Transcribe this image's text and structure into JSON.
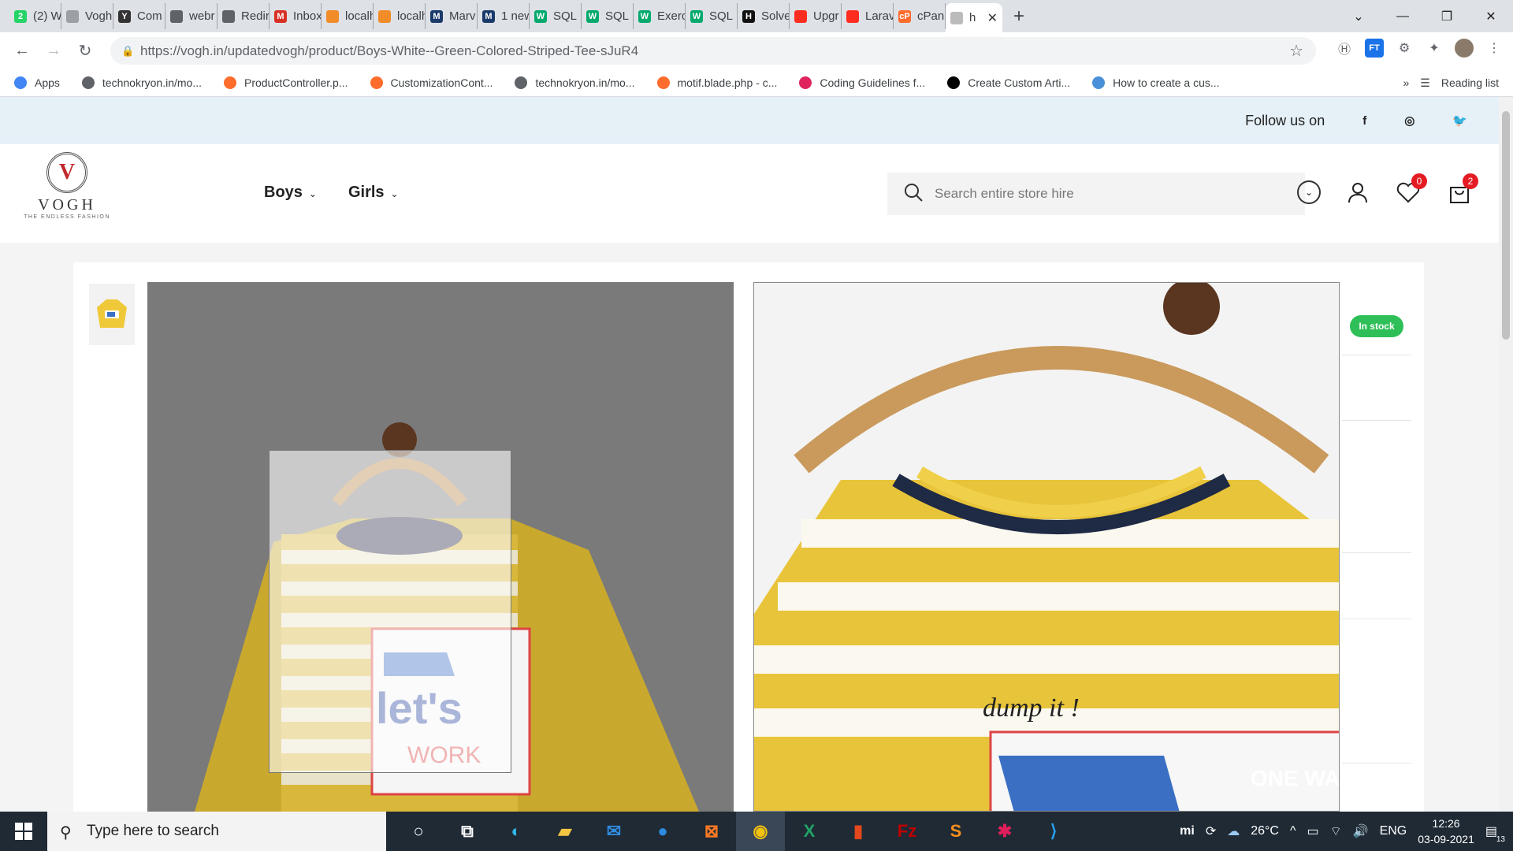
{
  "browser": {
    "tabs": [
      {
        "label": "(2) W",
        "icon": "whatsapp-icon",
        "color": "#25d366",
        "glyph": "2"
      },
      {
        "label": "Vogh",
        "icon": "page-icon",
        "color": "#9aa0a6",
        "glyph": ""
      },
      {
        "label": "Com",
        "icon": "yahoo-icon",
        "color": "#333333",
        "glyph": "Y"
      },
      {
        "label": "webr",
        "icon": "globe-icon",
        "color": "#5f6368",
        "glyph": ""
      },
      {
        "label": "Redir",
        "icon": "globe-icon",
        "color": "#5f6368",
        "glyph": ""
      },
      {
        "label": "Inbox",
        "icon": "gmail-icon",
        "color": "#d93025",
        "glyph": "M"
      },
      {
        "label": "localh",
        "icon": "phpmyadmin-icon",
        "color": "#f28c28",
        "glyph": ""
      },
      {
        "label": "localh",
        "icon": "phpmyadmin-icon",
        "color": "#f28c28",
        "glyph": ""
      },
      {
        "label": "Marv",
        "icon": "m-icon",
        "color": "#1a3a6b",
        "glyph": "M"
      },
      {
        "label": "1 new",
        "icon": "m-icon",
        "color": "#1a3a6b",
        "glyph": "M"
      },
      {
        "label": "SQL",
        "icon": "w3schools-icon",
        "color": "#04aa6d",
        "glyph": "W"
      },
      {
        "label": "SQL",
        "icon": "w3schools-icon",
        "color": "#04aa6d",
        "glyph": "W"
      },
      {
        "label": "Exerc",
        "icon": "w3schools-icon",
        "color": "#04aa6d",
        "glyph": "W"
      },
      {
        "label": "SQL",
        "icon": "w3schools-icon",
        "color": "#04aa6d",
        "glyph": "W"
      },
      {
        "label": "Solve",
        "icon": "hackerrank-icon",
        "color": "#111111",
        "glyph": "H"
      },
      {
        "label": "Upgr",
        "icon": "laravel-icon",
        "color": "#ff2d20",
        "glyph": ""
      },
      {
        "label": "Larav",
        "icon": "laravel-icon",
        "color": "#ff2d20",
        "glyph": ""
      },
      {
        "label": "cPan",
        "icon": "cpanel-icon",
        "color": "#ff6c2c",
        "glyph": "cP"
      }
    ],
    "active_tab": {
      "label": "h",
      "icon": "page-icon"
    },
    "url": "https://vogh.in/updatedvogh/product/Boys-White--Green-Colored-Striped-Tee-sJuR4",
    "bookmarks": [
      {
        "label": "Apps",
        "icon": "apps-grid-icon",
        "color": "#4285f4"
      },
      {
        "label": "technokryon.in/mo...",
        "icon": "globe-icon",
        "color": "#5f6368"
      },
      {
        "label": "ProductController.p...",
        "icon": "cpanel-icon",
        "color": "#ff6c2c"
      },
      {
        "label": "CustomizationCont...",
        "icon": "cpanel-icon",
        "color": "#ff6c2c"
      },
      {
        "label": "technokryon.in/mo...",
        "icon": "globe-icon",
        "color": "#5f6368"
      },
      {
        "label": "motif.blade.php - c...",
        "icon": "cpanel-icon",
        "color": "#ff6c2c"
      },
      {
        "label": "Coding Guidelines f...",
        "icon": "laravel-icon",
        "color": "#e0245e"
      },
      {
        "label": "Create Custom Arti...",
        "icon": "medium-icon",
        "color": "#000000"
      },
      {
        "label": "How to create a cus...",
        "icon": "code-icon",
        "color": "#4a90d9"
      }
    ],
    "more": "»",
    "reading_list": "Reading list"
  },
  "site": {
    "follow_label": "Follow us on",
    "logo": {
      "name": "VOGH",
      "tagline": "THE ENDLESS FASHION",
      "mark": "V"
    },
    "menu": [
      {
        "label": "Boys"
      },
      {
        "label": "Girls"
      }
    ],
    "search_placeholder": "Search entire store hire",
    "wishlist_count": "0",
    "cart_count": "2",
    "stock_label": "In stock",
    "colors": {
      "accent_red": "#e51b23",
      "stock_green": "#2ebf58",
      "strip": "#e5f0f7"
    }
  },
  "taskbar": {
    "search_placeholder": "Type here to search",
    "weather": "26°C",
    "language": "ENG",
    "time": "12:26",
    "date": "03-09-2021",
    "notifications": "13"
  }
}
